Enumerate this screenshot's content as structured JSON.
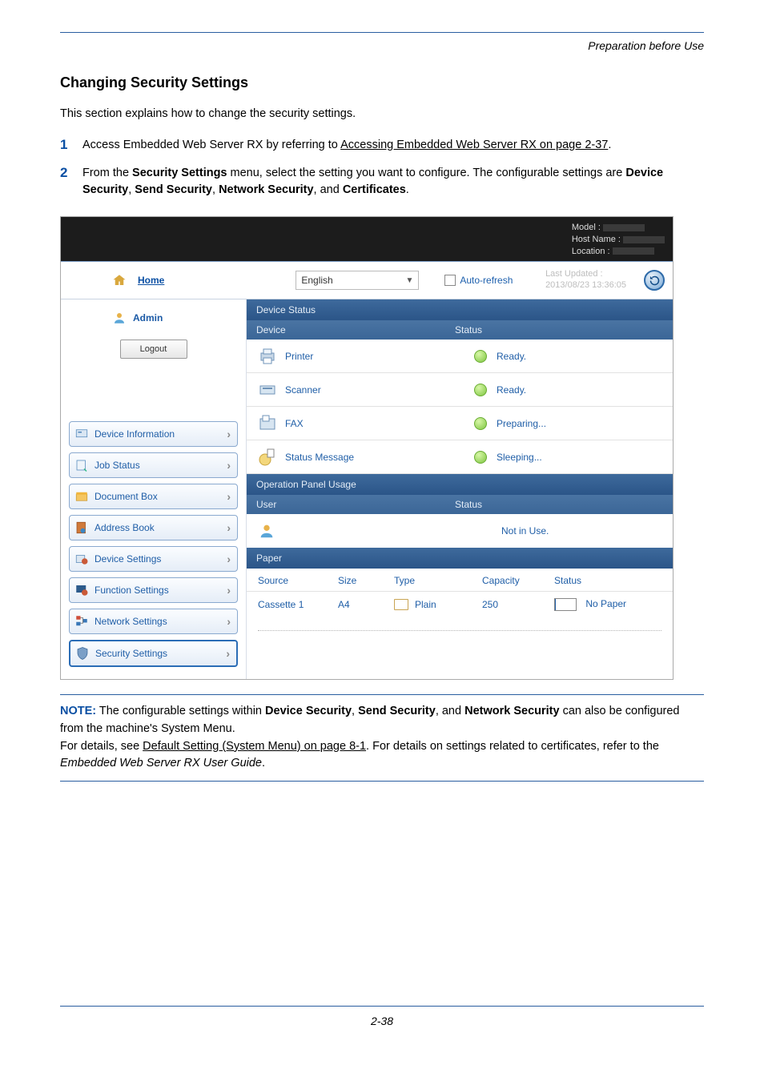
{
  "header_right": "Preparation before Use",
  "title": "Changing Security Settings",
  "intro": "This section explains how to change the security settings.",
  "steps": [
    {
      "num": "1",
      "pre": "Access Embedded Web Server RX by referring to ",
      "link": "Accessing Embedded Web Server RX on page 2-37",
      "post": "."
    },
    {
      "num": "2",
      "pre": "From the ",
      "b1": "Security Settings",
      "mid1": " menu, select the setting you want to configure. The configurable settings are ",
      "b2": "Device Security",
      "mid2": ", ",
      "b3": "Send Security",
      "mid3": ", ",
      "b4": "Network Security",
      "mid4": ", and ",
      "b5": "Certificates",
      "post": "."
    }
  ],
  "ss": {
    "top": {
      "model": "Model :",
      "host": "Host Name :",
      "loc": "Location :"
    },
    "homebar": {
      "home": "Home",
      "language": "English",
      "auto_refresh": "Auto-refresh",
      "last_updated_lbl": "Last Updated :",
      "last_updated_val": "2013/08/23 13:36:05"
    },
    "side": {
      "admin": "Admin",
      "logout": "Logout",
      "items": [
        {
          "label": "Device Information"
        },
        {
          "label": "Job Status"
        },
        {
          "label": "Document Box"
        },
        {
          "label": "Address Book"
        },
        {
          "label": "Device Settings"
        },
        {
          "label": "Function Settings"
        },
        {
          "label": "Network Settings"
        },
        {
          "label": "Security Settings"
        }
      ]
    },
    "main": {
      "device_status_title": "Device Status",
      "device_col": "Device",
      "status_col": "Status",
      "rows": [
        {
          "name": "Printer",
          "status": "Ready."
        },
        {
          "name": "Scanner",
          "status": "Ready."
        },
        {
          "name": "FAX",
          "status": "Preparing..."
        },
        {
          "name": "Status Message",
          "status": "Sleeping..."
        }
      ],
      "panel_usage_title": "Operation Panel Usage",
      "user_col": "User",
      "notinuse": "Not in Use.",
      "paper_title": "Paper",
      "paper_cols": {
        "source": "Source",
        "size": "Size",
        "type": "Type",
        "capacity": "Capacity",
        "status": "Status"
      },
      "paper_row": {
        "source": "Cassette 1",
        "size": "A4",
        "type": "Plain",
        "capacity": "250",
        "status": "No Paper"
      }
    }
  },
  "note": {
    "label": "NOTE:",
    "t1": " The configurable settings within ",
    "b1": "Device Security",
    "t2": ", ",
    "b2": "Send Security",
    "t3": ", and ",
    "b3": "Network Security",
    "t4": " can also be configured from the machine's System Menu.",
    "line2_pre": "For details, see ",
    "line2_link": "Default Setting (System Menu) on page 8-1",
    "line2_mid": ". For details on settings related to certificates, refer to the ",
    "line2_it": "Embedded Web Server RX User Guide",
    "line2_post": "."
  },
  "page_num": "2-38"
}
